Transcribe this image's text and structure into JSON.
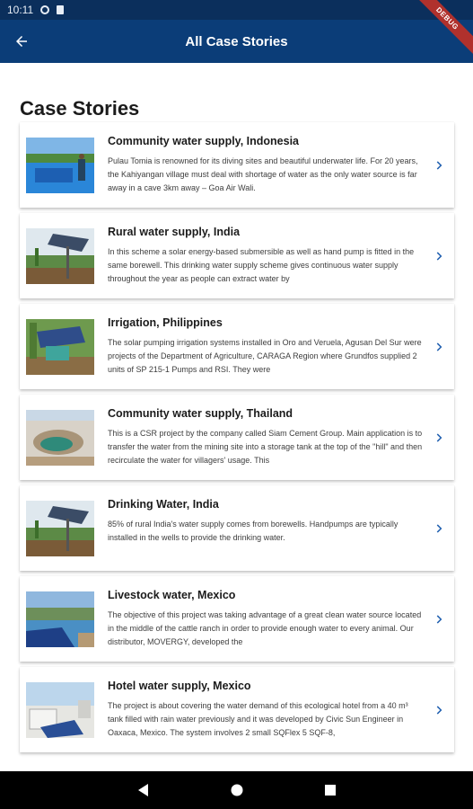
{
  "status_bar": {
    "time": "10:11"
  },
  "debug_banner": "DEBUG",
  "app_bar": {
    "title": "All Case Stories",
    "back_icon": "arrow-back-icon"
  },
  "page_title": "Case Stories",
  "stories": [
    {
      "title": "Community water supply, Indonesia",
      "description": "Pulau Tomia is renowned for its diving sites and beautiful underwater life. For 20 years, the Kahiyangan village must deal with shortage of water as the only water source is far away in a cave 3km away – Goa Air Wali.",
      "thumb": "indonesia"
    },
    {
      "title": "Rural water supply, India",
      "description": "In this scheme a solar energy-based submersible as well as hand pump is fitted in the same borewell. This drinking water supply scheme gives continuous water supply throughout the year as people can extract water by",
      "thumb": "solar-field"
    },
    {
      "title": "Irrigation, Philippines",
      "description": "The solar pumping irrigation systems installed in Oro and Veruela, Agusan Del Sur were projects of the Department of Agriculture, CARAGA Region where Grundfos supplied 2 units of SP 215-1 Pumps and RSI. They were",
      "thumb": "philippines"
    },
    {
      "title": "Community water supply, Thailand",
      "description": "This is a CSR project by the company called Siam Cement Group. Main application is to transfer the water from the mining site into a storage tank at the top of the \"hill\" and then recirculate the water for villagers' usage. This",
      "thumb": "thailand"
    },
    {
      "title": "Drinking Water, India",
      "description": "85% of rural India's water supply comes from borewells. Handpumps are typically installed in the wells to provide the drinking water.",
      "thumb": "solar-field"
    },
    {
      "title": "Livestock water, Mexico",
      "description": "The objective of this project was taking advantage of a great clean water source located in the middle of the cattle ranch in order to provide enough water to every animal. Our distributor, MOVERGY, developed the",
      "thumb": "mexico-livestock"
    },
    {
      "title": "Hotel water supply, Mexico",
      "description": "The project is about covering the water demand of this ecological hotel from a 40 m³ tank filled with rain water previously and it was developed by Civic Sun Engineer in Oaxaca, Mexico. The system involves 2 small SQFlex 5 SQF-8,",
      "thumb": "mexico-hotel"
    }
  ],
  "nav_bar": {
    "back_icon": "nav-back-icon",
    "home_icon": "nav-home-icon",
    "recents_icon": "nav-recents-icon"
  },
  "colors": {
    "app_bar": "#0b3d78",
    "status_bar": "#0b2f5c",
    "chevron": "#1f5fb0",
    "debug": "#b0312d"
  }
}
